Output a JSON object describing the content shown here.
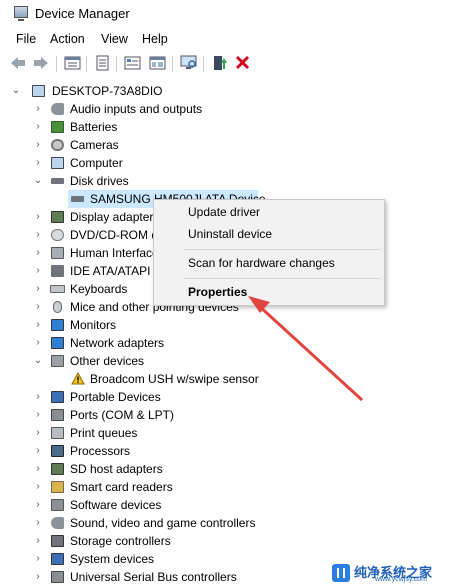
{
  "window": {
    "title": "Device Manager"
  },
  "menubar": [
    "File",
    "Action",
    "View",
    "Help"
  ],
  "toolbar": {
    "icons": [
      "back-arrow-icon",
      "forward-arrow-icon",
      "properties-grid-icon",
      "help-doc-icon",
      "computer-list-icon",
      "device-grid-icon",
      "monitor-scan-icon",
      "update-driver-icon",
      "uninstall-x-icon"
    ]
  },
  "tree": {
    "root": "DESKTOP-73A8DIO",
    "items": [
      {
        "label": "Audio inputs and outputs",
        "icon": "speaker-icon",
        "expanded": false
      },
      {
        "label": "Batteries",
        "icon": "battery-icon",
        "expanded": false
      },
      {
        "label": "Cameras",
        "icon": "camera-icon",
        "expanded": false
      },
      {
        "label": "Computer",
        "icon": "computer-icon",
        "expanded": false
      },
      {
        "label": "Disk drives",
        "icon": "disk-drive-icon",
        "expanded": true
      },
      {
        "label": "SAMSUNG HM500JI ATA Device",
        "icon": "disk-drive-icon",
        "child": true,
        "selected": true
      },
      {
        "label": "Display adapters",
        "icon": "display-adapter-icon",
        "expanded": false
      },
      {
        "label": "DVD/CD-ROM drives",
        "icon": "dvd-drive-icon",
        "expanded": false
      },
      {
        "label": "Human Interface Devices",
        "icon": "hid-icon",
        "expanded": false
      },
      {
        "label": "IDE ATA/ATAPI controllers",
        "icon": "ide-controller-icon",
        "expanded": false
      },
      {
        "label": "Keyboards",
        "icon": "keyboard-icon",
        "expanded": false
      },
      {
        "label": "Mice and other pointing devices",
        "icon": "mouse-icon",
        "expanded": false
      },
      {
        "label": "Monitors",
        "icon": "monitor-icon",
        "expanded": false
      },
      {
        "label": "Network adapters",
        "icon": "network-adapter-icon",
        "expanded": false
      },
      {
        "label": "Other devices",
        "icon": "other-devices-icon",
        "expanded": true
      },
      {
        "label": "Broadcom USH w/swipe sensor",
        "icon": "warning-device-icon",
        "child": true
      },
      {
        "label": "Portable Devices",
        "icon": "portable-device-icon",
        "expanded": false
      },
      {
        "label": "Ports (COM & LPT)",
        "icon": "port-icon",
        "expanded": false
      },
      {
        "label": "Print queues",
        "icon": "printer-icon",
        "expanded": false
      },
      {
        "label": "Processors",
        "icon": "processor-icon",
        "expanded": false
      },
      {
        "label": "SD host adapters",
        "icon": "sd-card-icon",
        "expanded": false
      },
      {
        "label": "Smart card readers",
        "icon": "smart-card-icon",
        "expanded": false
      },
      {
        "label": "Software devices",
        "icon": "software-device-icon",
        "expanded": false
      },
      {
        "label": "Sound, video and game controllers",
        "icon": "sound-controller-icon",
        "expanded": false
      },
      {
        "label": "Storage controllers",
        "icon": "storage-controller-icon",
        "expanded": false
      },
      {
        "label": "System devices",
        "icon": "system-device-icon",
        "expanded": false
      },
      {
        "label": "Universal Serial Bus controllers",
        "icon": "usb-icon",
        "expanded": false
      }
    ]
  },
  "context_menu": {
    "update_driver": "Update driver",
    "uninstall_device": "Uninstall device",
    "scan_changes": "Scan for hardware changes",
    "properties": "Properties"
  },
  "watermark": {
    "name": "纯净系统之家",
    "url": "www.ycwjsy.com"
  },
  "colors": {
    "selection": "#cce8ff",
    "arrow": "#e0463f",
    "menu_bg": "#f2f2f2",
    "uninstall_x": "#d0021b"
  }
}
